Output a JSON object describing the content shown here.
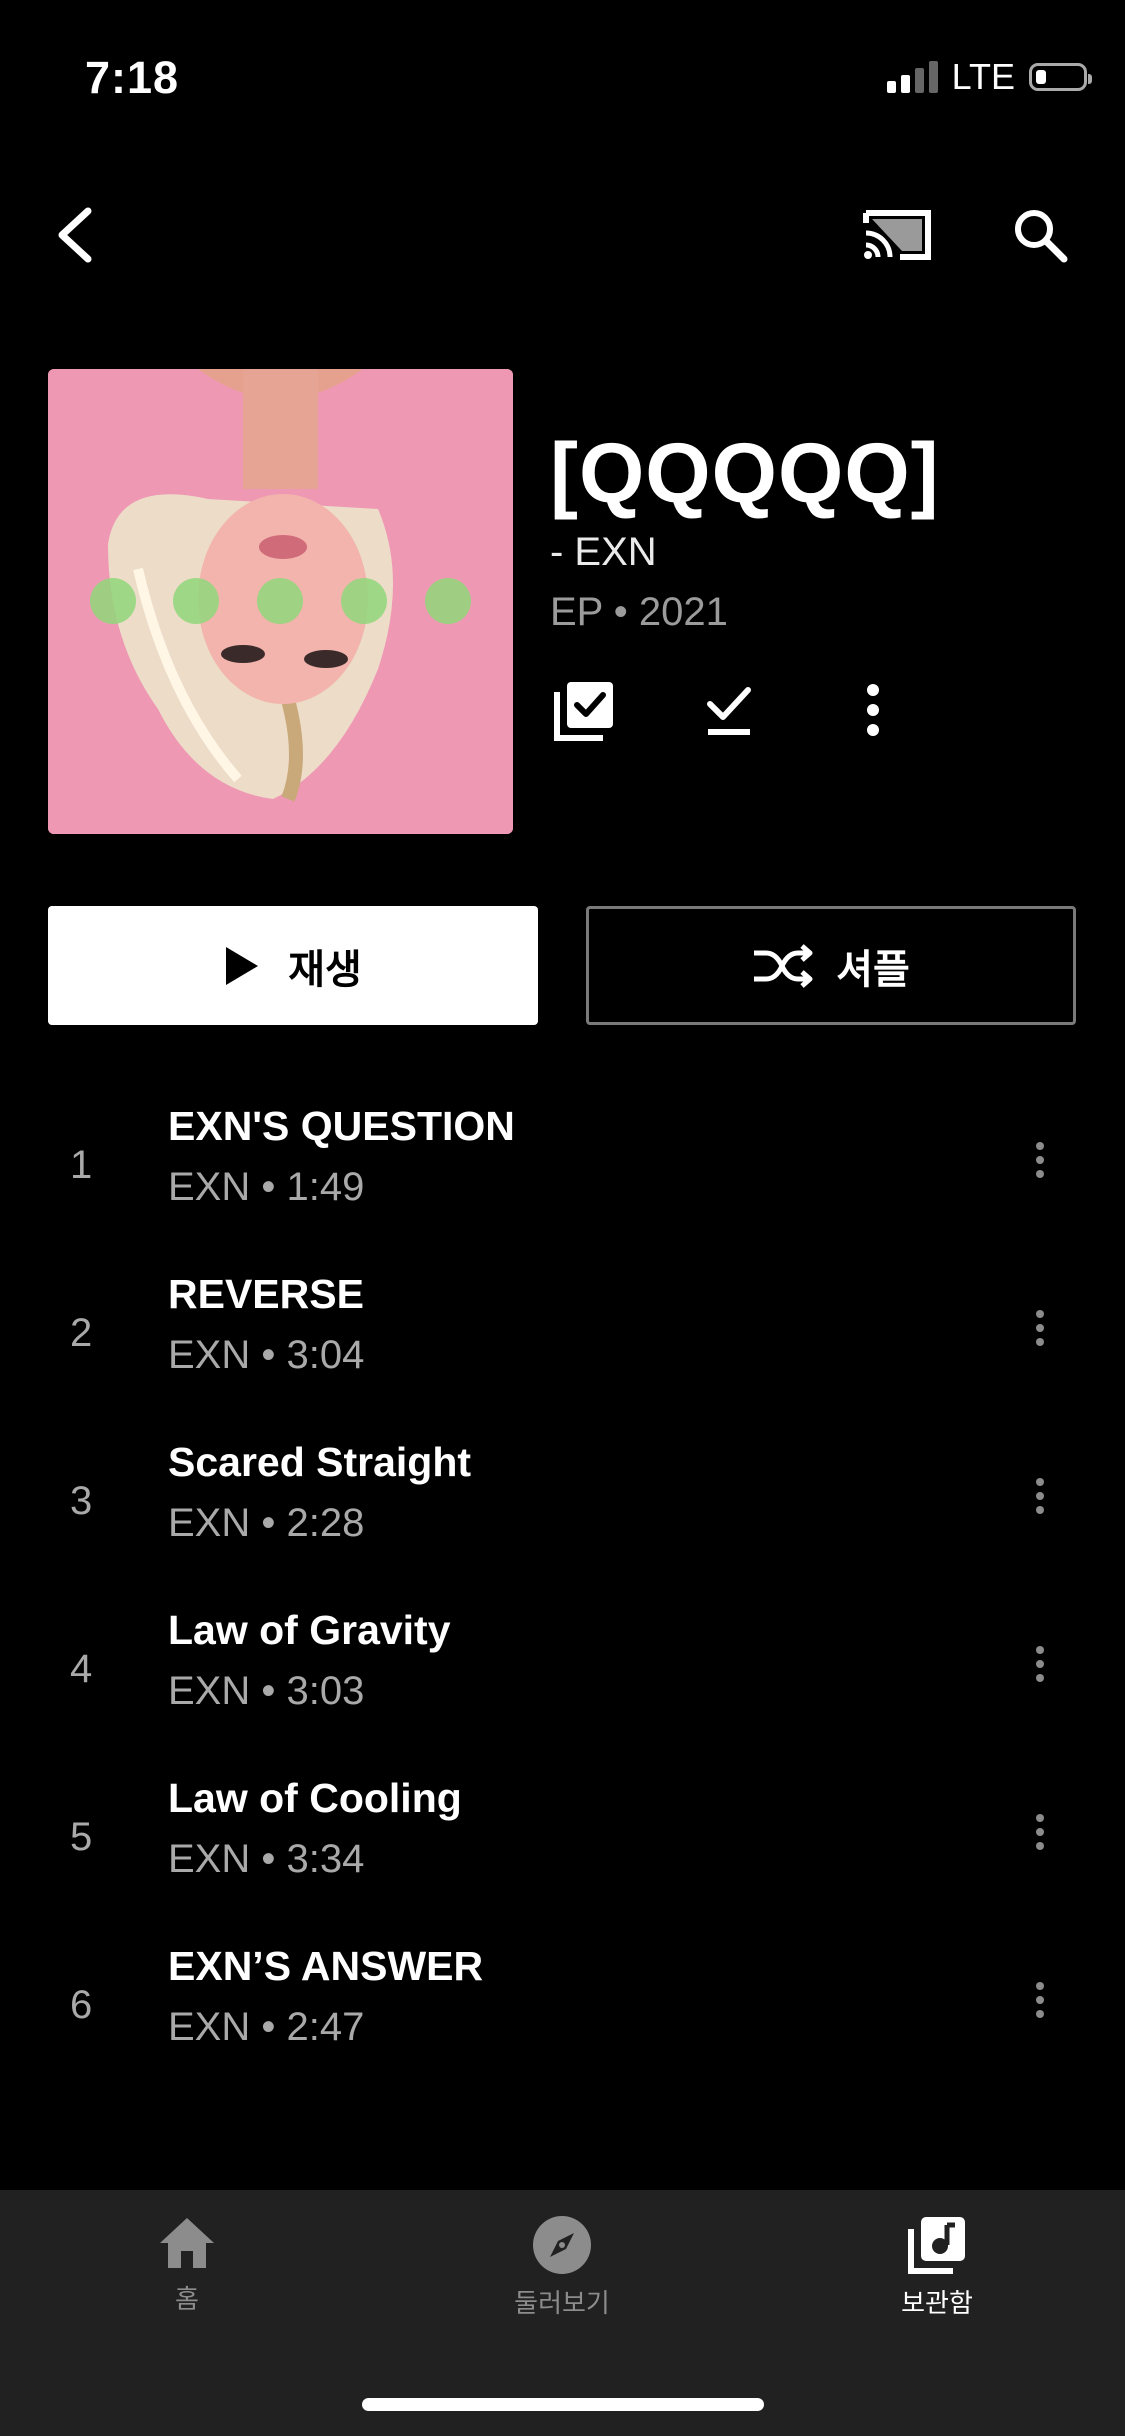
{
  "status": {
    "time": "7:18",
    "network": "LTE"
  },
  "album": {
    "title": "[QQQQQ]",
    "artist": "- EXN",
    "meta": "EP • 2021"
  },
  "buttons": {
    "play": "재생",
    "shuffle": "셔플"
  },
  "tracks": [
    {
      "num": "1",
      "title": "EXN'S QUESTION",
      "sub": "EXN • 1:49"
    },
    {
      "num": "2",
      "title": "REVERSE",
      "sub": "EXN • 3:04"
    },
    {
      "num": "3",
      "title": "Scared Straight",
      "sub": "EXN • 2:28"
    },
    {
      "num": "4",
      "title": "Law of Gravity",
      "sub": "EXN • 3:03"
    },
    {
      "num": "5",
      "title": "Law of Cooling",
      "sub": "EXN • 3:34"
    },
    {
      "num": "6",
      "title": "EXN’S ANSWER",
      "sub": "EXN • 2:47"
    }
  ],
  "nav": {
    "home": "홈",
    "explore": "둘러보기",
    "library": "보관함"
  },
  "colors": {
    "background": "#000000",
    "nav_bg": "#212121",
    "inactive": "#8c8c8c",
    "cover_pink": "#ef98b4"
  },
  "icons": {
    "back": "chevron-left-icon",
    "cast": "cast-icon",
    "search": "search-icon",
    "library_add": "library-add-check-icon",
    "download": "download-done-icon",
    "more": "more-vertical-icon",
    "play": "play-icon",
    "shuffle": "shuffle-icon",
    "home": "home-icon",
    "explore": "compass-icon",
    "library": "library-music-icon"
  }
}
